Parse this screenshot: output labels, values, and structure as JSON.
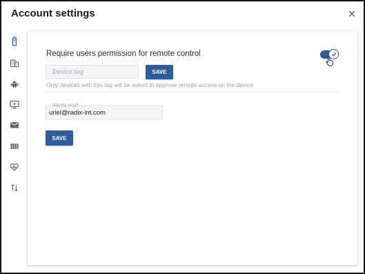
{
  "dialog": {
    "title": "Account settings"
  },
  "sidebar": {
    "items": [
      {
        "icon": "remote-icon",
        "active": true
      },
      {
        "icon": "building-icon",
        "active": false
      },
      {
        "icon": "android-icon",
        "active": false
      },
      {
        "icon": "screen-share-icon",
        "active": false
      },
      {
        "icon": "mail-icon",
        "active": false
      },
      {
        "icon": "barcode-icon",
        "active": false
      },
      {
        "icon": "heart-pulse-icon",
        "active": false
      },
      {
        "icon": "transfer-icon",
        "active": false
      }
    ]
  },
  "remote_control": {
    "title": "Require users permission for remote control",
    "toggle_on": true,
    "device_tag_placeholder": "Device tag",
    "device_tag_value": "",
    "save_label": "SAVE",
    "help_text": "Only devices with this tag will be asked to approve remote access on the device"
  },
  "alerts": {
    "label": "Alerts mail",
    "value": "uriel@radix-int.com",
    "save_label": "SAVE"
  },
  "colors": {
    "primary": "#2d5b9c",
    "active_icon": "#2d5b9c",
    "inactive_icon": "#5f6670"
  }
}
